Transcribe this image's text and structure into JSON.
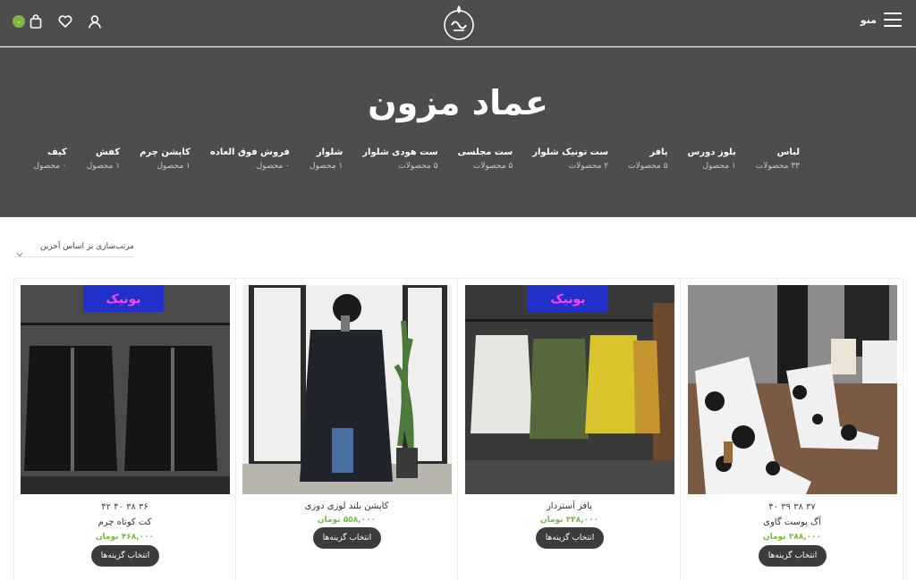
{
  "header": {
    "menu_label": "منو",
    "cart_count": "۰",
    "icons": [
      "menu-icon",
      "logo",
      "cart-icon",
      "heart-icon",
      "user-icon"
    ]
  },
  "hero": {
    "title": "عماد مزون",
    "categories": [
      {
        "name": "لباس",
        "count": "۳۳ محصولات"
      },
      {
        "name": "بلوز دورس",
        "count": "۱ محصول"
      },
      {
        "name": "پافر",
        "count": "۵ محصولات"
      },
      {
        "name": "ست تونیک شلوار",
        "count": "۲ محصولات"
      },
      {
        "name": "ست مجلسی",
        "count": "۵ محصولات"
      },
      {
        "name": "ست هودی شلوار",
        "count": "۵ محصولات"
      },
      {
        "name": "شلوار",
        "count": "۱ محصول"
      },
      {
        "name": "فروش فوق العاده",
        "count": "۰ محصول"
      },
      {
        "name": "کاپشن چرم",
        "count": "۱ محصول"
      },
      {
        "name": "کفش",
        "count": "۱ محصول"
      },
      {
        "name": "کیف",
        "count": "۰ محصول"
      }
    ]
  },
  "sort": {
    "label": "مرتب‌سازی بر اساس آخرین"
  },
  "products": [
    {
      "sizes": "۳۷ ۳۸ ۳۹ ۴۰",
      "name": "آگ پوست گاوی",
      "price": "۳۸۸,۰۰۰ تومان",
      "button": "انتخاب گزینه‌ها"
    },
    {
      "sizes": "",
      "name": "پافر آستردار",
      "price": "۳۳۸,۰۰۰ تومان",
      "button": "انتخاب گزینه‌ها"
    },
    {
      "sizes": "",
      "name": "کاپشن بلند لوزی دوزی",
      "price": "۵۵۸,۰۰۰ تومان",
      "button": "انتخاب گزینه‌ها"
    },
    {
      "sizes": "۳۶ ۳۸ ۴۰ ۴۲",
      "name": "کت کوتاه چرم",
      "price": "۴۶۸,۰۰۰ تومان",
      "button": "انتخاب گزینه‌ها"
    }
  ],
  "colors": {
    "header_bg": "#4e4c4c",
    "accent_green": "#7ab943",
    "button_bg": "#3d3b3b"
  }
}
